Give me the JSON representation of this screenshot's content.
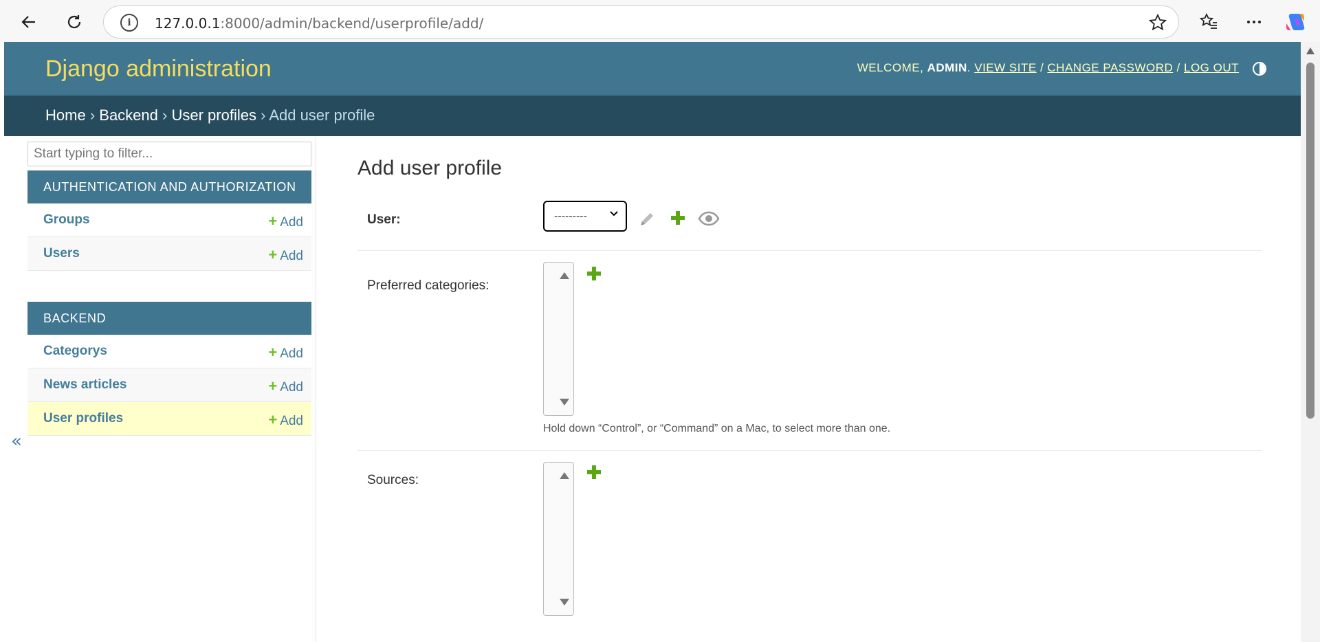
{
  "browser": {
    "url_host": "127.0.0.1",
    "url_rest": ":8000/admin/backend/userprofile/add/"
  },
  "header": {
    "site_name": "Django administration",
    "welcome": "WELCOME,",
    "username": "ADMIN",
    "view_site": "VIEW SITE",
    "change_password": "CHANGE PASSWORD",
    "log_out": "LOG OUT",
    "sep": "/"
  },
  "breadcrumbs": {
    "items": [
      "Home",
      "Backend",
      "User profiles"
    ],
    "current": "Add user profile",
    "sep": "›"
  },
  "sidebar": {
    "filter_placeholder": "Start typing to filter...",
    "add_label": "Add",
    "modules": [
      {
        "name": "AUTHENTICATION AND AUTHORIZATION",
        "models": [
          "Groups",
          "Users"
        ]
      },
      {
        "name": "BACKEND",
        "models": [
          "Categorys",
          "News articles",
          "User profiles"
        ]
      }
    ],
    "current_model": "User profiles",
    "collapse_glyph": "«"
  },
  "form": {
    "title": "Add user profile",
    "user_label": "User:",
    "user_value": "---------",
    "preferred_label": "Preferred categories:",
    "help_text": "Hold down “Control”, or “Command” on a Mac, to select more than one.",
    "sources_label": "Sources:"
  },
  "colors": {
    "header": "#417690",
    "breadcrumbs": "#264b5d",
    "site_name": "#f5dd5d",
    "add_plus": "#70bf2b",
    "link": "#447e9b",
    "current_row": "#ffffcc"
  }
}
